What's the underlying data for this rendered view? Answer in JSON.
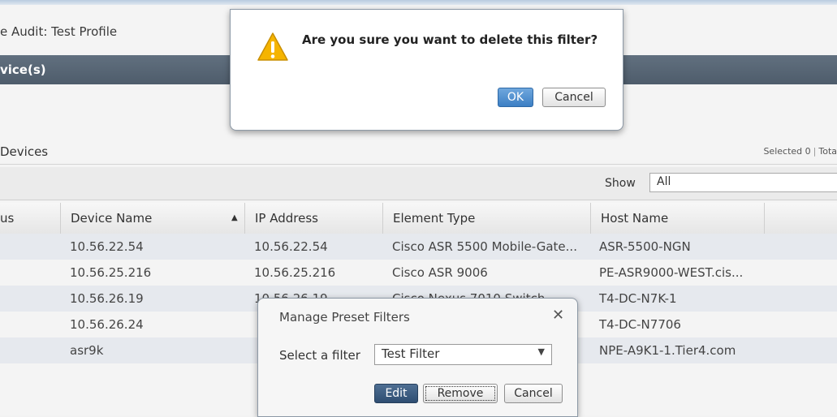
{
  "page": {
    "title": "e Audit: Test Profile",
    "section_title": "vice(s)",
    "devices_heading": "Devices",
    "selected_text": "Selected 0",
    "total_text": "Tota"
  },
  "toolbar": {
    "show_label": "Show",
    "show_value": "All"
  },
  "grid": {
    "columns": [
      "us",
      "Device Name",
      "IP Address",
      "Element Type",
      "Host Name"
    ],
    "sort_indicator": "▲",
    "rows": [
      {
        "device_name": "10.56.22.54",
        "ip": "10.56.22.54",
        "element_type": "Cisco ASR 5500 Mobile-Gate...",
        "host": "ASR-5500-NGN"
      },
      {
        "device_name": "10.56.25.216",
        "ip": "10.56.25.216",
        "element_type": "Cisco ASR 9006",
        "host": "PE-ASR9000-WEST.cis..."
      },
      {
        "device_name": "10.56.26.19",
        "ip": "10.56.26.19",
        "element_type": "Cisco Nexus 7010 Switch",
        "host": "T4-DC-N7K-1"
      },
      {
        "device_name": "10.56.26.24",
        "ip": "",
        "element_type": "",
        "host": "T4-DC-N7706"
      },
      {
        "device_name": "asr9k",
        "ip": "",
        "element_type": "",
        "host": "NPE-A9K1-1.Tier4.com"
      }
    ]
  },
  "confirm_dialog": {
    "message": "Are you sure you want to delete this filter?",
    "ok_label": "OK",
    "cancel_label": "Cancel",
    "icon": "warning-icon"
  },
  "preset_dialog": {
    "title": "Manage Preset Filters",
    "close_glyph": "✕",
    "filter_label": "Select a filter",
    "filter_value": "Test Filter",
    "edit_label": "Edit",
    "remove_label": "Remove",
    "cancel_label": "Cancel"
  },
  "colors": {
    "section_bar": "#56626f",
    "primary_button": "#3c7fc4",
    "row_alt": "#e6e9ee",
    "warning": "#f5b400"
  }
}
